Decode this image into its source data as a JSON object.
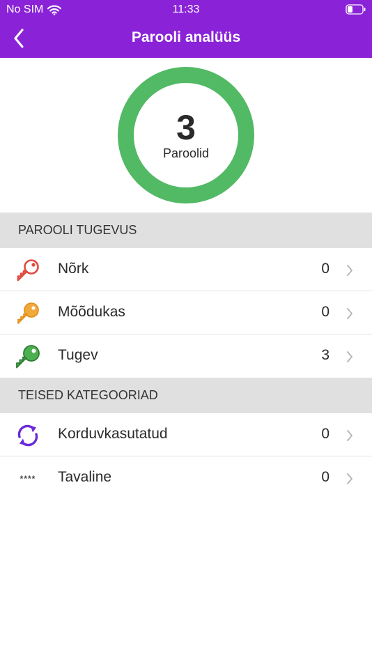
{
  "status_bar": {
    "carrier": "No SIM",
    "time": "11:33"
  },
  "nav": {
    "title": "Parooli analüüs",
    "back_icon": "chevron-left-icon"
  },
  "summary": {
    "count": "3",
    "label": "Paroolid",
    "ring_color": "#52b965"
  },
  "strength_section": {
    "header": "PAROOLI TUGEVUS",
    "items": [
      {
        "label": "Nõrk",
        "value": "0",
        "icon": "key-icon",
        "color": "#e04b3f"
      },
      {
        "label": "Mõõdukas",
        "value": "0",
        "icon": "key-icon",
        "color": "#f2a93b"
      },
      {
        "label": "Tugev",
        "value": "3",
        "icon": "key-icon",
        "color": "#4caf50"
      }
    ]
  },
  "other_section": {
    "header": "TEISED KATEGOORIAD",
    "items": [
      {
        "label": "Korduvkasutatud",
        "value": "0",
        "icon": "refresh-icon",
        "color": "#6a2bd9"
      },
      {
        "label": "Tavaline",
        "value": "0",
        "icon": "asterisks-icon",
        "glyph": "****"
      }
    ]
  },
  "colors": {
    "accent": "#8a22d8",
    "section_bg": "#e0e0e0"
  }
}
